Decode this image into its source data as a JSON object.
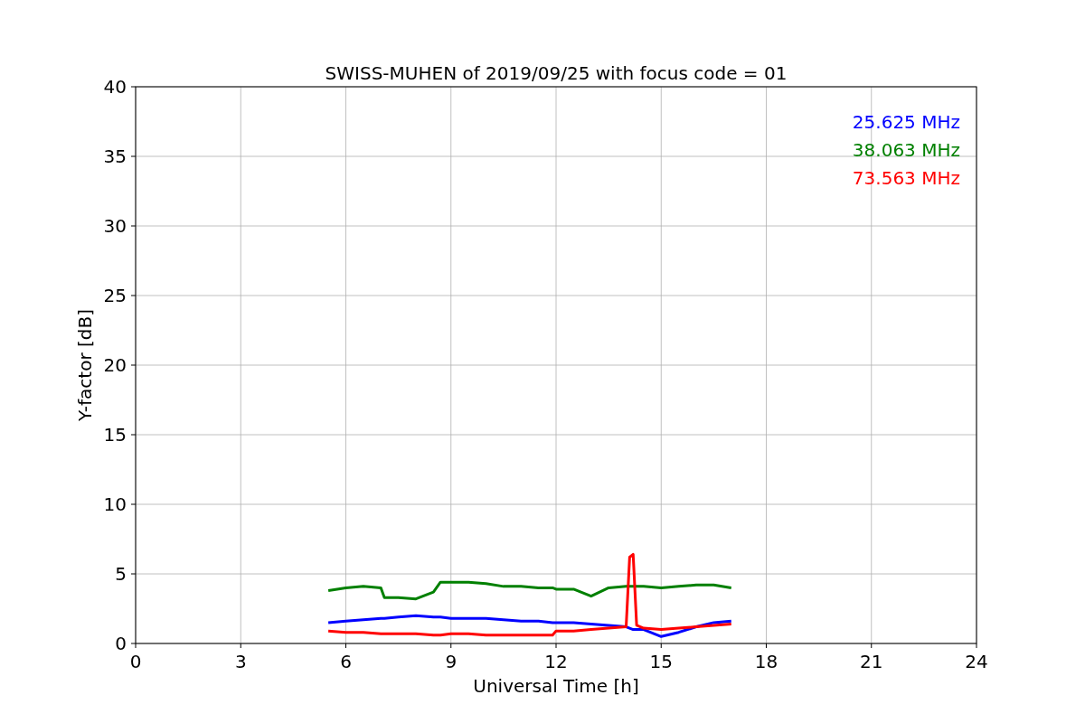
{
  "figure": {
    "chart_data": {
      "type": "line",
      "title": "SWISS-MUHEN of 2019/09/25 with focus code = 01",
      "xlabel": "Universal Time [h]",
      "ylabel": "Y-factor [dB]",
      "x": [
        5.5,
        6,
        6.5,
        7,
        7.1,
        7.5,
        8,
        8.5,
        8.7,
        9,
        9.5,
        10,
        10.5,
        11,
        11.5,
        11.9,
        12,
        12.5,
        13,
        13.5,
        14,
        14.1,
        14.2,
        14.3,
        14.5,
        15,
        15.5,
        16,
        16.5,
        17
      ],
      "series": [
        {
          "name": "25.625 MHz",
          "color": "#0000ff",
          "values": [
            1.5,
            1.6,
            1.7,
            1.8,
            1.8,
            1.9,
            2.0,
            1.9,
            1.9,
            1.8,
            1.8,
            1.8,
            1.7,
            1.6,
            1.6,
            1.5,
            1.5,
            1.5,
            1.4,
            1.3,
            1.2,
            1.1,
            1.0,
            1.0,
            1.0,
            0.5,
            0.8,
            1.2,
            1.5,
            1.6
          ]
        },
        {
          "name": "38.063 MHz",
          "color": "#008000",
          "values": [
            3.8,
            4.0,
            4.1,
            4.0,
            3.3,
            3.3,
            3.2,
            3.7,
            4.4,
            4.4,
            4.4,
            4.3,
            4.1,
            4.1,
            4.0,
            4.0,
            3.9,
            3.9,
            3.4,
            4.0,
            4.1,
            4.1,
            4.1,
            4.1,
            4.1,
            4.0,
            4.1,
            4.2,
            4.2,
            4.0
          ]
        },
        {
          "name": "73.563 MHz",
          "color": "#ff0000",
          "values": [
            0.9,
            0.8,
            0.8,
            0.7,
            0.7,
            0.7,
            0.7,
            0.6,
            0.6,
            0.7,
            0.7,
            0.6,
            0.6,
            0.6,
            0.6,
            0.6,
            0.9,
            0.9,
            1.0,
            1.1,
            1.2,
            6.2,
            6.4,
            1.3,
            1.1,
            1.0,
            1.1,
            1.2,
            1.3,
            1.4
          ]
        }
      ],
      "grid": true,
      "xlim": [
        0,
        24
      ],
      "ylim": [
        0,
        40
      ],
      "xticks": [
        0,
        3,
        6,
        9,
        12,
        15,
        18,
        21,
        24
      ],
      "yticks": [
        0,
        5,
        10,
        15,
        20,
        25,
        30,
        35,
        40
      ]
    }
  }
}
